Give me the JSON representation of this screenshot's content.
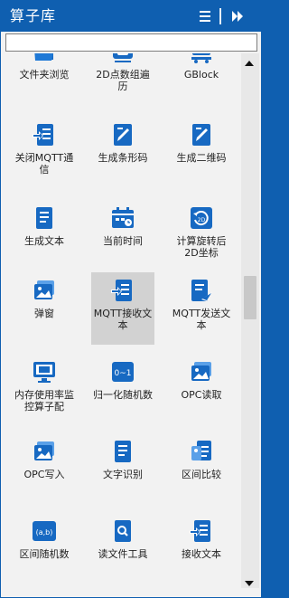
{
  "header": {
    "title": "算子库"
  },
  "search": {
    "placeholder": "",
    "value": ""
  },
  "rows": [
    {
      "items": [
        {
          "label": "文件夹浏览",
          "icon": "folder-icon"
        },
        {
          "label": "2D点数组遍历",
          "icon": "point-array-icon"
        },
        {
          "label": "GBlock",
          "icon": "gblock-icon"
        }
      ]
    },
    {
      "items": [
        {
          "label": "关闭MQTT通信",
          "icon": "document-in-icon"
        },
        {
          "label": "生成条形码",
          "icon": "document-edit-icon"
        },
        {
          "label": "生成二维码",
          "icon": "document-edit-icon"
        }
      ]
    },
    {
      "items": [
        {
          "label": "生成文本",
          "icon": "document-text-icon"
        },
        {
          "label": "当前时间",
          "icon": "calendar-icon"
        },
        {
          "label": "计算旋转后2D坐标",
          "icon": "rotate-icon"
        }
      ]
    },
    {
      "items": [
        {
          "label": "弹窗",
          "icon": "image-stack-icon"
        },
        {
          "label": "MQTT接收文本",
          "icon": "document-in-icon",
          "selected": true
        },
        {
          "label": "MQTT发送文本",
          "icon": "document-send-icon"
        }
      ]
    },
    {
      "items": [
        {
          "label": "内存使用率监控算子配",
          "icon": "monitor-icon"
        },
        {
          "label": "归一化随机数",
          "icon": "normalize-icon"
        },
        {
          "label": "OPC读取",
          "icon": "image-stack-icon"
        }
      ]
    },
    {
      "items": [
        {
          "label": "OPC写入",
          "icon": "image-stack-icon"
        },
        {
          "label": "文字识别",
          "icon": "document-text-icon"
        },
        {
          "label": "区间比较",
          "icon": "compare-icon"
        }
      ]
    },
    {
      "items": [
        {
          "label": "区间随机数",
          "icon": "range-random-icon"
        },
        {
          "label": "读文件工具",
          "icon": "file-search-icon"
        },
        {
          "label": "接收文本",
          "icon": "document-in-icon"
        }
      ]
    }
  ],
  "colors": {
    "accent": "#0f5fb0",
    "icon": "#1769c2",
    "background": "#f2f2f2",
    "selected": "#d2d2d2"
  }
}
